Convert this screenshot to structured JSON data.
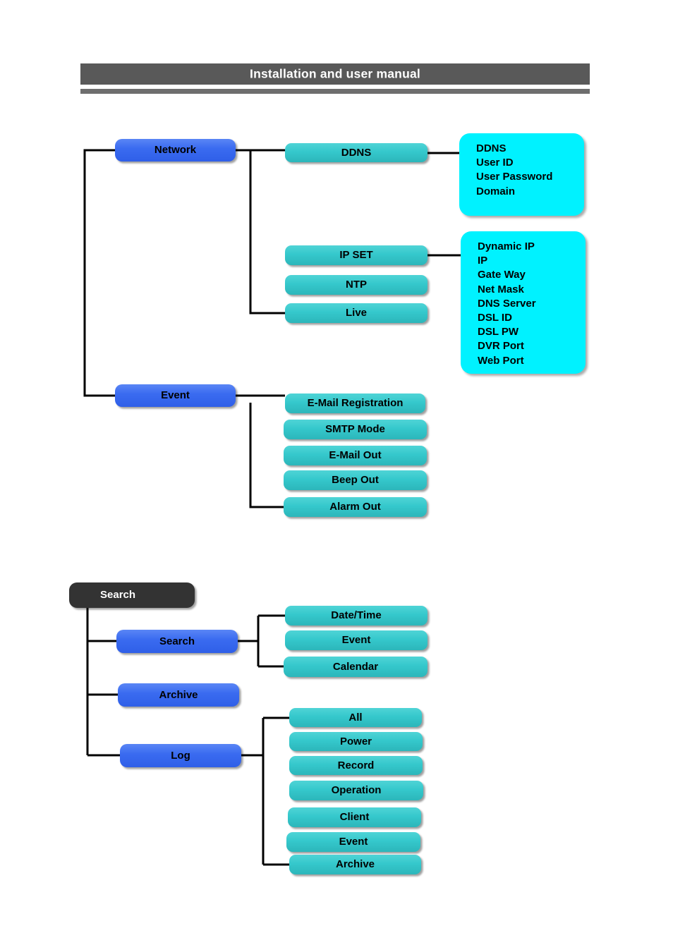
{
  "header": {
    "title": "Installation and user manual"
  },
  "diagram": {
    "type": "menu-tree",
    "sections": [
      {
        "id": "network-section",
        "level1": [
          {
            "id": "network",
            "label": "Network",
            "style": "blue"
          },
          {
            "id": "event",
            "label": "Event",
            "style": "blue"
          }
        ],
        "network_children": [
          {
            "id": "ddns",
            "label": "DDNS",
            "style": "teal"
          },
          {
            "id": "ip-set",
            "label": "IP SET",
            "style": "teal"
          },
          {
            "id": "ntp",
            "label": "NTP",
            "style": "teal"
          },
          {
            "id": "live",
            "label": "Live",
            "style": "teal"
          }
        ],
        "event_children": [
          {
            "id": "email-registration",
            "label": "E-Mail Registration",
            "style": "teal"
          },
          {
            "id": "smtp-mode",
            "label": "SMTP Mode",
            "style": "teal"
          },
          {
            "id": "email-out",
            "label": "E-Mail Out",
            "style": "teal"
          },
          {
            "id": "beep-out",
            "label": "Beep Out",
            "style": "teal"
          },
          {
            "id": "alarm-out",
            "label": "Alarm Out",
            "style": "teal"
          }
        ],
        "ddns_details": [
          "DDNS",
          "User ID",
          "User Password",
          "Domain"
        ],
        "ipset_details": [
          "Dynamic IP",
          "IP",
          "Gate Way",
          "Net Mask",
          "DNS Server",
          "DSL ID",
          "DSL PW",
          "DVR Port",
          "Web Port"
        ]
      },
      {
        "id": "search-section",
        "root": {
          "id": "search-root",
          "label": "Search",
          "style": "dark"
        },
        "level1": [
          {
            "id": "search",
            "label": "Search",
            "style": "blue"
          },
          {
            "id": "archive",
            "label": "Archive",
            "style": "blue"
          },
          {
            "id": "log",
            "label": "Log",
            "style": "blue"
          }
        ],
        "search_children": [
          {
            "id": "date-time",
            "label": "Date/Time",
            "style": "teal"
          },
          {
            "id": "search-event",
            "label": "Event",
            "style": "teal"
          },
          {
            "id": "calendar",
            "label": "Calendar",
            "style": "teal"
          }
        ],
        "log_children": [
          {
            "id": "log-all",
            "label": "All",
            "style": "teal"
          },
          {
            "id": "log-power",
            "label": "Power",
            "style": "teal"
          },
          {
            "id": "log-record",
            "label": "Record",
            "style": "teal"
          },
          {
            "id": "log-operation",
            "label": "Operation",
            "style": "teal"
          },
          {
            "id": "log-client",
            "label": "Client",
            "style": "teal"
          },
          {
            "id": "log-event",
            "label": "Event",
            "style": "teal"
          },
          {
            "id": "log-archive",
            "label": "Archive",
            "style": "teal"
          }
        ]
      }
    ]
  },
  "colors": {
    "header_bar": "#595959",
    "header_rule": "#6e6e6e",
    "blue_node": "#3a6bf0",
    "teal_node": "#35c8cc",
    "cyan_panel": "#00f2ff",
    "dark_node": "#333333",
    "connector": "#000000"
  }
}
